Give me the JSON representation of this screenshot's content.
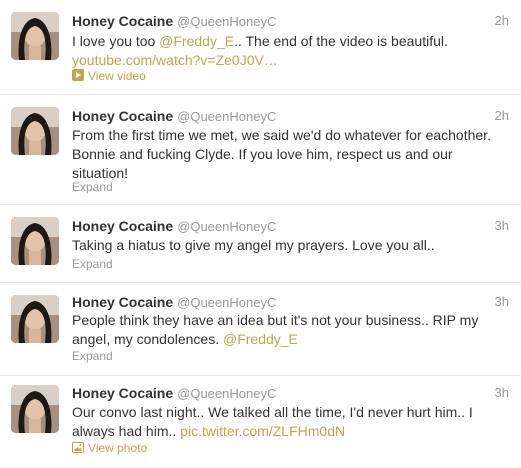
{
  "colors": {
    "link": "#c8a24a",
    "name": "#333333",
    "meta": "#999999",
    "divider": "#e8e8e8"
  },
  "tweets": [
    {
      "name": "Honey Cocaine",
      "handle": "@QueenHoneyC",
      "time": "2h",
      "text_before": "I love you too ",
      "mention": "@Freddy_E",
      "text_after": ".. The end of the video is beautiful.",
      "url": "youtube.com/watch?v=Ze0J0V…",
      "action": "View video",
      "action_icon": "play-icon"
    },
    {
      "name": "Honey Cocaine",
      "handle": "@QueenHoneyC",
      "time": "2h",
      "text_line1": "From the first time we met, we said we'd do whatever for eachother.",
      "text_line2": "Bonnie and fucking Clyde. If you love him, respect us and our",
      "text_line3": "situation!",
      "action": "Expand"
    },
    {
      "name": "Honey Cocaine",
      "handle": "@QueenHoneyC",
      "time": "3h",
      "text": "Taking a hiatus to give my angel my prayers. Love you all..",
      "action": "Expand"
    },
    {
      "name": "Honey Cocaine",
      "handle": "@QueenHoneyC",
      "time": "3h",
      "text_line1": "People think they have an idea but it's not your business.. RIP my",
      "text_line2_before": "angel, my condolences. ",
      "mention": "@Freddy_E",
      "action": "Expand"
    },
    {
      "name": "Honey Cocaine",
      "handle": "@QueenHoneyC",
      "time": "3h",
      "text_line1": "Our convo last night.. We talked all the time, I'd never hurt him.. I",
      "text_line2_before": "always had him.. ",
      "url": "pic.twitter.com/ZLFHm0dN",
      "action": "View photo",
      "action_icon": "photo-icon"
    }
  ]
}
